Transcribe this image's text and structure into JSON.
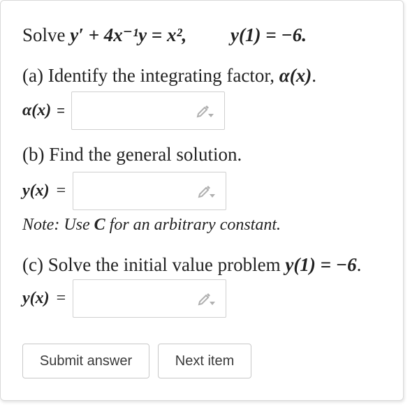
{
  "problem": {
    "prefix": "Solve",
    "equation": "y′ + 4x⁻¹y = x²,",
    "condition": "y(1) = −6."
  },
  "part_a": {
    "text": "(a) Identify the integrating factor, ",
    "math": "α(x)",
    "end": ".",
    "label": "α(x)",
    "eq": "=",
    "input_value": ""
  },
  "part_b": {
    "text": "(b) Find the general solution.",
    "label": "y(x)",
    "eq": "=",
    "input_value": ""
  },
  "note": {
    "prefix": "Note: Use ",
    "symbol": "C",
    "suffix": " for an arbitrary constant."
  },
  "part_c": {
    "text": "(c) Solve the initial value problem ",
    "math": "y(1) = −6",
    "end": ".",
    "label": "y(x)",
    "eq": "=",
    "input_value": ""
  },
  "buttons": {
    "submit": "Submit answer",
    "next": "Next item"
  },
  "icons": {
    "edit": "pencil-icon"
  },
  "colors": {
    "icon": "#b0b0b0",
    "border": "#d0d0d0",
    "text": "#222222"
  }
}
